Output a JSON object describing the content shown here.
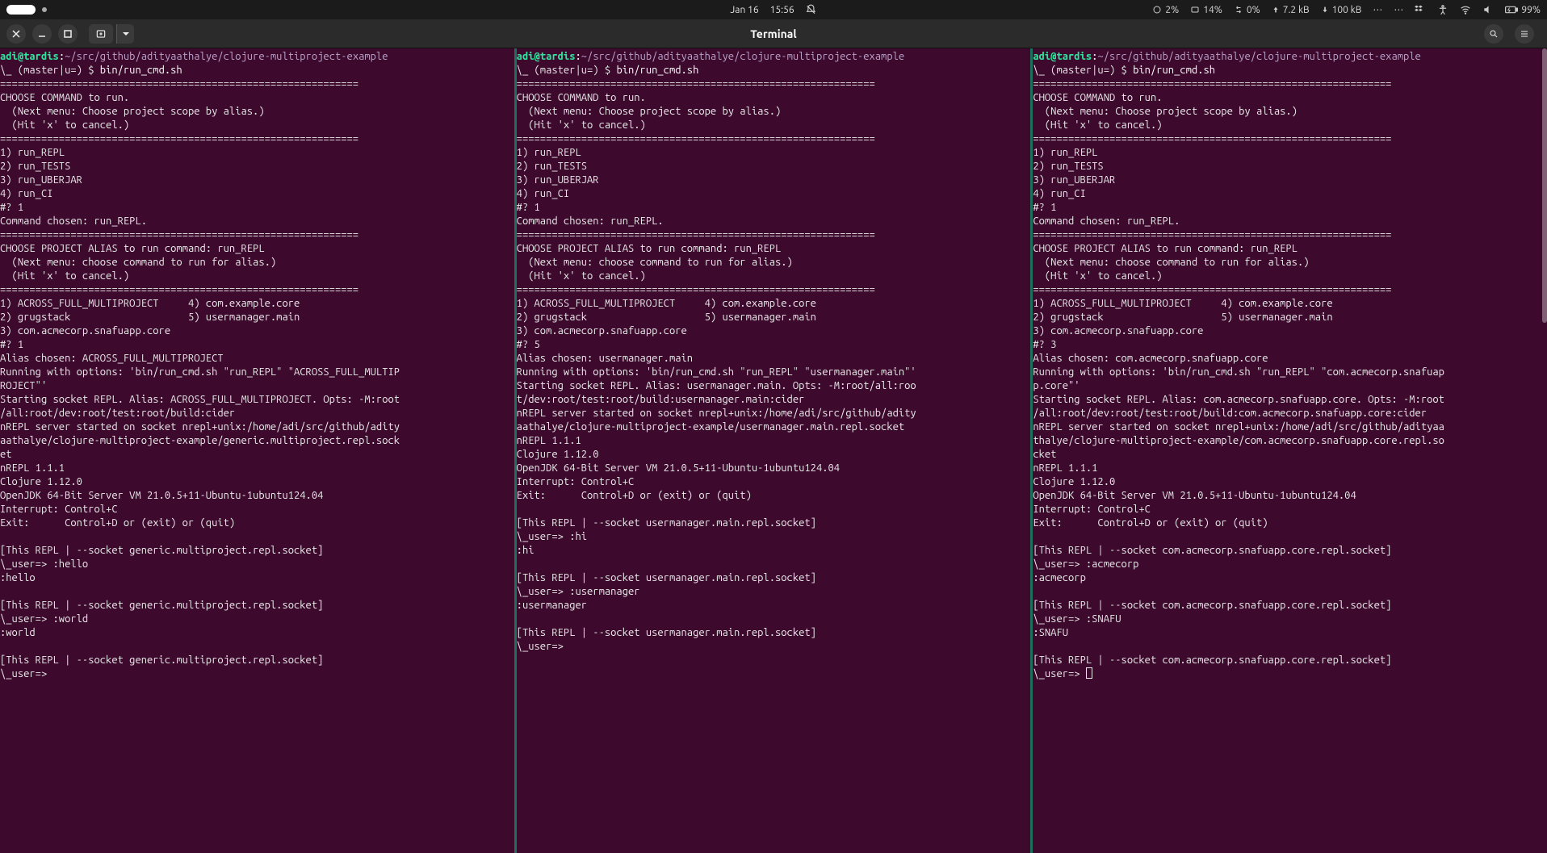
{
  "sysbar": {
    "date": "Jan 16",
    "time": "15:56",
    "cpu_pct": "2%",
    "mem_pct": "14%",
    "swap_pct": "0%",
    "net_up": "7.2 kB",
    "net_down": "100 kB",
    "battery": "99%"
  },
  "window": {
    "title": "Terminal"
  },
  "prompt": {
    "userhost": "adi@tardis",
    "colon": ":",
    "path": "~/src/github/adityaathalye/clojure-multiproject-example",
    "branch": "\\_ (master|u=) $ ",
    "cmd": "bin/run_cmd.sh"
  },
  "divider": "=============================================================",
  "menu1": {
    "title": "CHOOSE COMMAND to run.",
    "hint1": "  (Next menu: Choose project scope by alias.)",
    "hint2": "  (Hit 'x' to cancel.)",
    "opt1": "1) run_REPL",
    "opt2": "2) run_TESTS",
    "opt3": "3) run_UBERJAR",
    "opt4": "4) run_CI",
    "prompt": "#? 1",
    "chosen": "Command chosen: run_REPL."
  },
  "menu2_common": {
    "title": "CHOOSE PROJECT ALIAS to run command: run_REPL",
    "hint1": "  (Next menu: choose command to run for alias.)",
    "hint2": "  (Hit 'x' to cancel.)",
    "row1": "1) ACROSS_FULL_MULTIPROJECT     4) com.example.core",
    "row2": "2) grugstack                    5) usermanager.main",
    "row3": "3) com.acmecorp.snafuapp.core"
  },
  "pane1": {
    "menu2_prompt": "#? 1",
    "alias_line": "Alias chosen: ACROSS_FULL_MULTIPROJECT",
    "running": "Running with options: 'bin/run_cmd.sh \"run_REPL\" \"ACROSS_FULL_MULTIPROJECT\"'",
    "starting1": "Starting socket REPL. Alias: ACROSS_FULL_MULTIPROJECT. Opts: -M:root/all:root/dev:root/test:root/build:cider",
    "nrepl_started": "nREPL server started on socket nrepl+unix:/home/adi/src/github/adityaathalye/clojure-multiproject-example/generic.multiproject.repl.socket",
    "nrepl_ver": "nREPL 1.1.1",
    "clojure": "Clojure 1.12.0",
    "jdk": "OpenJDK 64-Bit Server VM 21.0.5+11-Ubuntu-1ubuntu124.04",
    "interrupt": "Interrupt: Control+C",
    "exit": "Exit:      Control+D or (exit) or (quit)",
    "socket_label": "[This REPL | --socket generic.multiproject.repl.socket]",
    "repl1_in": "\\_user=> :hello",
    "repl1_out": ":hello",
    "repl2_in": "\\_user=> :world",
    "repl2_out": ":world",
    "repl3_in": "\\_user=> "
  },
  "pane2": {
    "menu2_prompt": "#? 5",
    "alias_line": "Alias chosen: usermanager.main",
    "running": "Running with options: 'bin/run_cmd.sh \"run_REPL\" \"usermanager.main\"'",
    "starting1": "Starting socket REPL. Alias: usermanager.main. Opts: -M:root/all:root/dev:root/test:root/build:usermanager.main:cider",
    "nrepl_started": "nREPL server started on socket nrepl+unix:/home/adi/src/github/adityaathalye/clojure-multiproject-example/usermanager.main.repl.socket",
    "nrepl_ver": "nREPL 1.1.1",
    "clojure": "Clojure 1.12.0",
    "jdk": "OpenJDK 64-Bit Server VM 21.0.5+11-Ubuntu-1ubuntu124.04",
    "interrupt": "Interrupt: Control+C",
    "exit": "Exit:      Control+D or (exit) or (quit)",
    "socket_label": "[This REPL | --socket usermanager.main.repl.socket]",
    "repl1_in": "\\_user=> :hi",
    "repl1_out": ":hi",
    "repl2_in": "\\_user=> :usermanager",
    "repl2_out": ":usermanager",
    "repl3_in": "\\_user=> "
  },
  "pane3": {
    "menu2_prompt": "#? 3",
    "alias_line": "Alias chosen: com.acmecorp.snafuapp.core",
    "running": "Running with options: 'bin/run_cmd.sh \"run_REPL\" \"com.acmecorp.snafuapp.core\"'",
    "starting1": "Starting socket REPL. Alias: com.acmecorp.snafuapp.core. Opts: -M:root/all:root/dev:root/test:root/build:com.acmecorp.snafuapp.core:cider",
    "nrepl_started": "nREPL server started on socket nrepl+unix:/home/adi/src/github/adityaathalye/clojure-multiproject-example/com.acmecorp.snafuapp.core.repl.socket",
    "nrepl_ver": "nREPL 1.1.1",
    "clojure": "Clojure 1.12.0",
    "jdk": "OpenJDK 64-Bit Server VM 21.0.5+11-Ubuntu-1ubuntu124.04",
    "interrupt": "Interrupt: Control+C",
    "exit": "Exit:      Control+D or (exit) or (quit)",
    "socket_label": "[This REPL | --socket com.acmecorp.snafuapp.core.repl.socket]",
    "repl1_in": "\\_user=> :acmecorp",
    "repl1_out": ":acmecorp",
    "repl2_in": "\\_user=> :SNAFU",
    "repl2_out": ":SNAFU",
    "repl3_in": "\\_user=> "
  }
}
